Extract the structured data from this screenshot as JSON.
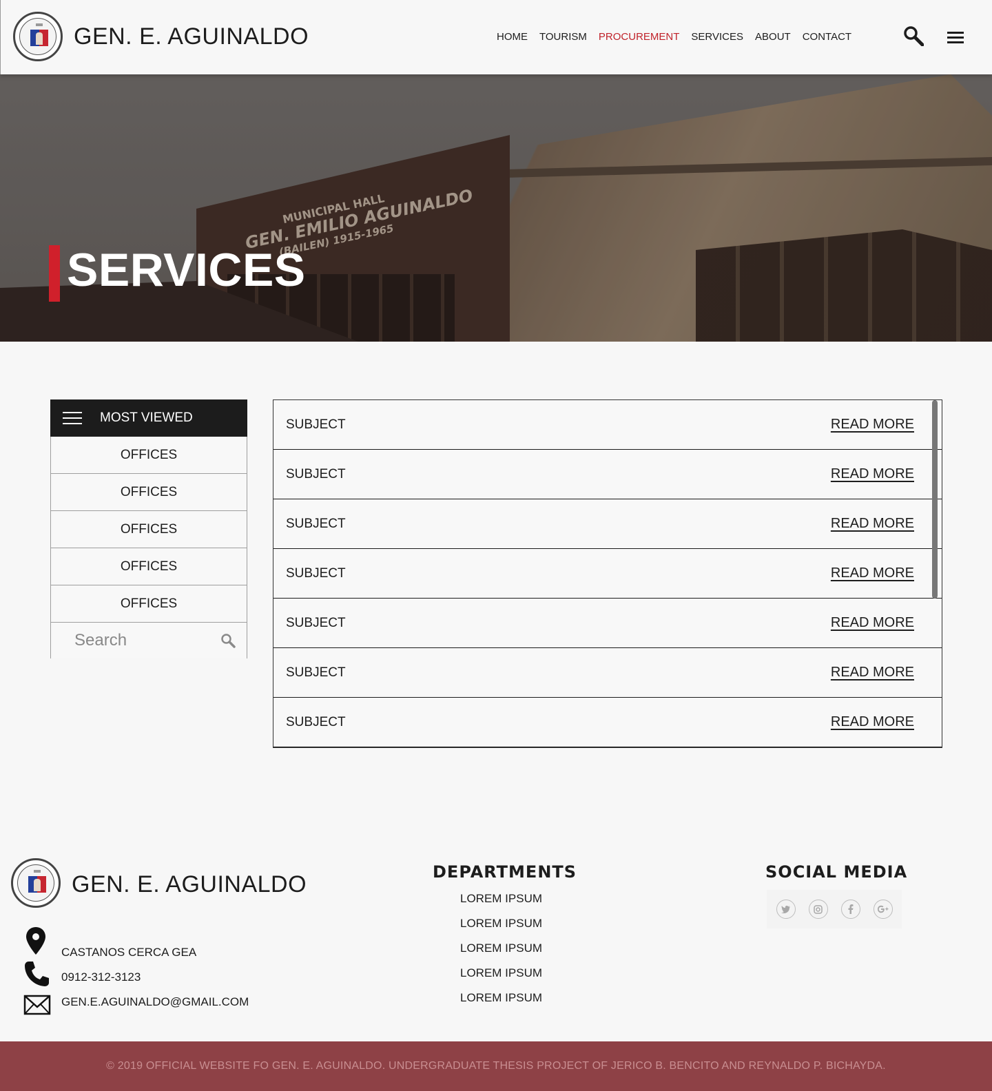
{
  "header": {
    "brand": "GEN. E. AGUINALDO",
    "nav": [
      {
        "label": "HOME",
        "active": false
      },
      {
        "label": "TOURISM",
        "active": false
      },
      {
        "label": "PROCUREMENT",
        "active": true
      },
      {
        "label": "SERVICES",
        "active": false
      },
      {
        "label": "ABOUT",
        "active": false
      },
      {
        "label": "CONTACT",
        "active": false
      }
    ],
    "icons": [
      "search-icon",
      "menu-icon"
    ]
  },
  "hero": {
    "title": "SERVICES",
    "photo_sign": {
      "line1": "MUNICIPAL HALL",
      "line2": "GEN. EMILIO AGUINALDO",
      "line3": "(BAILEN) 1915-1965"
    }
  },
  "sidebar": {
    "header": "MOST VIEWED",
    "items": [
      "OFFICES",
      "OFFICES",
      "OFFICES",
      "OFFICES",
      "OFFICES"
    ],
    "search_placeholder": "Search"
  },
  "list": {
    "rows": [
      {
        "subject": "SUBJECT",
        "link": "READ MORE"
      },
      {
        "subject": "SUBJECT",
        "link": "READ MORE"
      },
      {
        "subject": "SUBJECT",
        "link": "READ MORE"
      },
      {
        "subject": "SUBJECT",
        "link": "READ MORE"
      },
      {
        "subject": "SUBJECT",
        "link": "READ MORE"
      },
      {
        "subject": "SUBJECT",
        "link": "READ MORE"
      },
      {
        "subject": "SUBJECT",
        "link": "READ MORE"
      }
    ]
  },
  "footer": {
    "brand": "GEN. E. AGUINALDO",
    "address": "CASTANOS CERCA GEA",
    "phone": "0912-312-3123",
    "email": "GEN.E.AGUINALDO@GMAIL.COM",
    "departments_title": "DEPARTMENTS",
    "departments": [
      "LOREM IPSUM",
      "LOREM IPSUM",
      "LOREM IPSUM",
      "LOREM IPSUM",
      "LOREM IPSUM"
    ],
    "social_title": "SOCIAL MEDIA",
    "social_icons": [
      "twitter-icon",
      "instagram-icon",
      "facebook-icon",
      "google-plus-icon"
    ],
    "copyright": "© 2019 OFFICIAL WEBSITE FO GEN. E. AGUINALDO. UNDERGRADUATE THESIS PROJECT OF JERICO B. BENCITO AND REYNALDO P. BICHAYDA."
  },
  "colors": {
    "accent_red": "#c0222a",
    "hero_bar": "#d0202b",
    "sidebar_header": "#1c1c1c",
    "copyright_bg": "#8e4146"
  }
}
